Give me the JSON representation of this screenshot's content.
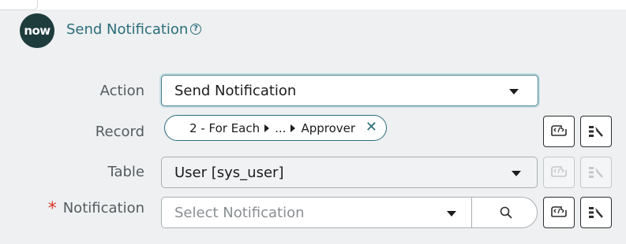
{
  "header": {
    "logo_text": "now",
    "step_title": "Send Notification",
    "help_icon": "help-circle-icon"
  },
  "fields": {
    "action": {
      "label": "Action",
      "value": "Send Notification"
    },
    "record": {
      "label": "Record",
      "pill": {
        "segment_1": "2 - For Each",
        "segment_2": "...",
        "segment_3": "Approver"
      },
      "clear_icon": "close-icon"
    },
    "table": {
      "label": "Table",
      "value": "User [sys_user]"
    },
    "notification": {
      "required_marker": "*",
      "label": "Notification",
      "placeholder": "Select Notification",
      "search_icon": "search-icon"
    }
  },
  "buttons": {
    "script_icon": "script-icon",
    "data_pill_picker_icon": "data-pill-picker-icon"
  },
  "colors": {
    "accent": "#2b6d7a",
    "required": "#d9352c",
    "logo_bg": "#1f3c3d",
    "page_bg": "#eef0f1"
  }
}
